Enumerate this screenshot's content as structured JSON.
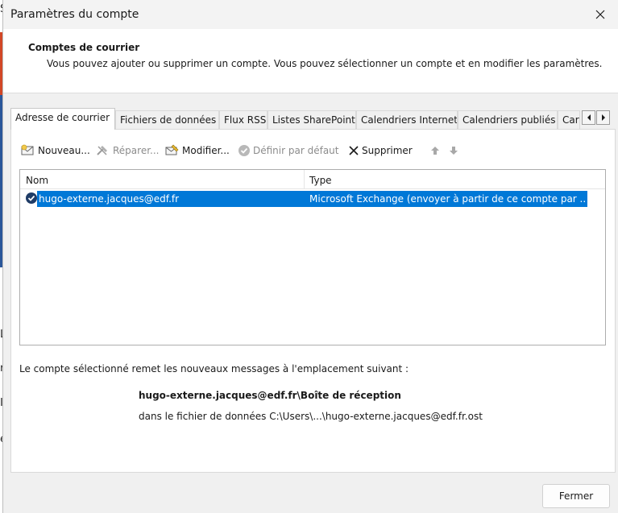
{
  "dialog": {
    "title": "Paramètres du compte",
    "header_title": "Comptes de courrier",
    "header_description": "Vous pouvez ajouter ou supprimer un compte. Vous pouvez sélectionner un compte et en modifier les paramètres."
  },
  "tabs": [
    {
      "label": "Adresse de courrier",
      "active": true
    },
    {
      "label": "Fichiers de données",
      "active": false
    },
    {
      "label": "Flux RSS",
      "active": false
    },
    {
      "label": "Listes SharePoint",
      "active": false
    },
    {
      "label": "Calendriers Internet",
      "active": false
    },
    {
      "label": "Calendriers publiés",
      "active": false
    },
    {
      "label": "Carnets d'adresses",
      "active": false
    }
  ],
  "toolbar": {
    "new_label": "Nouveau...",
    "repair_label": "Réparer...",
    "modify_label": "Modifier...",
    "set_default_label": "Définir par défaut",
    "delete_label": "Supprimer"
  },
  "account_list": {
    "columns": [
      "Nom",
      "Type"
    ],
    "rows": [
      {
        "name": "hugo-externe.jacques@edf.fr",
        "type": "Microsoft Exchange (envoyer à partir de ce compte par ...",
        "default": true,
        "selected": true
      }
    ]
  },
  "delivery": {
    "intro": "Le compte sélectionné remet les nouveaux messages à l'emplacement suivant :",
    "location": "hugo-externe.jacques@edf.fr\\Boîte de réception",
    "data_file": "dans le fichier de données C:\\Users\\...\\hugo-externe.jacques@edf.fr.ost"
  },
  "footer": {
    "close_label": "Fermer"
  },
  "background_fragments": [
    "S",
    "L",
    "r",
    "I",
    "e"
  ],
  "colors": {
    "selection": "#0078d7",
    "bg_app_orange": "#d24726",
    "bg_app_blue": "#2b579a"
  }
}
